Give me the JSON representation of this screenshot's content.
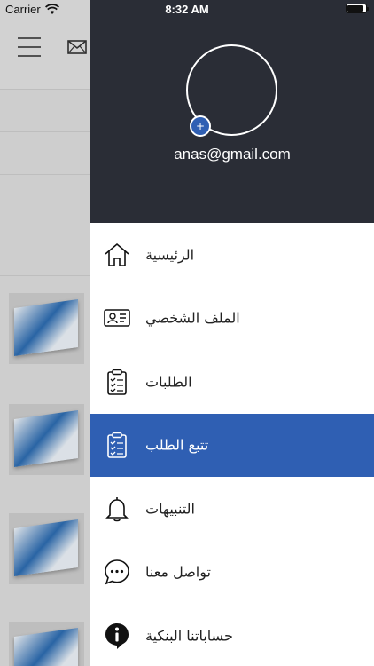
{
  "status_bar": {
    "carrier": "Carrier",
    "time": "8:32 AM"
  },
  "drawer": {
    "email": "anas@gmail.com",
    "avatar_add": "+",
    "items": [
      {
        "label": "الرئيسية",
        "icon": "home-icon",
        "active": false
      },
      {
        "label": "الملف الشخصي",
        "icon": "id-card-icon",
        "active": false
      },
      {
        "label": "الطلبات",
        "icon": "clipboard-icon",
        "active": false
      },
      {
        "label": "تتبع الطلب",
        "icon": "clipboard-icon",
        "active": true
      },
      {
        "label": "التنبيهات",
        "icon": "bell-icon",
        "active": false
      },
      {
        "label": "تواصل معنا",
        "icon": "chat-icon",
        "active": false
      },
      {
        "label": "حساباتنا البنكية",
        "icon": "info-icon",
        "active": false
      }
    ]
  },
  "colors": {
    "header_bg": "#2a2d36",
    "active_bg": "#2f5fb3"
  }
}
